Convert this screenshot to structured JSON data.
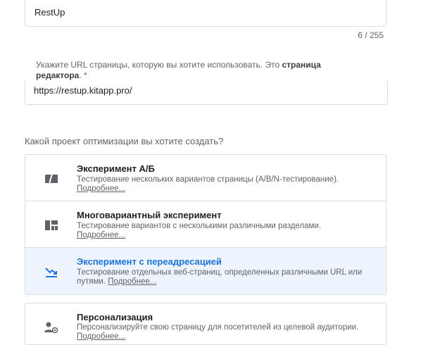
{
  "name_field": {
    "value": "RestUp",
    "counter": "6 / 255"
  },
  "url_field": {
    "label_prefix": "Укажите URL страницы, которую вы хотите использовать. Это ",
    "label_bold": "страница редактора",
    "label_suffix": ". *",
    "value": "https://restup.kitapp.pro/"
  },
  "question": "Какой проект оптимизации вы хотите создать?",
  "options": [
    {
      "icon": "ab-test-icon",
      "title": "Эксперимент A/Б",
      "description": "Тестирование нескольких вариантов страницы (A/B/N-тестирование).",
      "more": "Подробнее..."
    },
    {
      "icon": "multivariate-icon",
      "title": "Многовариантный эксперимент",
      "description": "Тестирование вариантов с несколькими различными разделами.",
      "more": "Подробнее..."
    },
    {
      "icon": "redirect-icon",
      "title": "Эксперимент с переадресацией",
      "description": "Тестирование отдельных веб-страниц, определенных различными URL или путями.",
      "more": "Подробнее...",
      "selected": true
    },
    {
      "icon": "personalization-icon",
      "title": "Персонализация",
      "description": "Персонализируйте свою страницу для посетителей из целевой аудитории.",
      "more": "Подробнее..."
    }
  ],
  "colors": {
    "accent": "#1a73e8",
    "selected_bg": "#eef4fd",
    "icon": "#5f6368"
  }
}
